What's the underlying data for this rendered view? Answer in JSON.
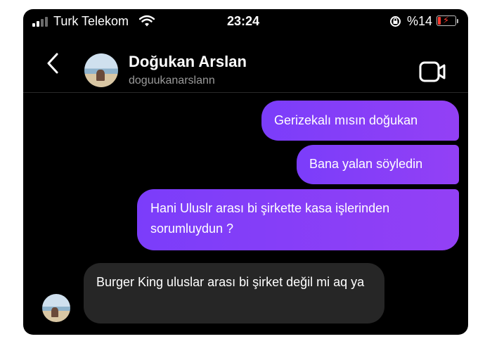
{
  "status_bar": {
    "carrier": "Turk Telekom",
    "time": "23:24",
    "battery_percent": "%14",
    "battery_level": 0.14,
    "signal_bars": 2,
    "battery_color": "#ff3b30"
  },
  "header": {
    "name": "Doğukan Arslan",
    "username": "doguukanarslann"
  },
  "messages": [
    {
      "sender": "me",
      "text": "Gerizekalı mısın doğukan"
    },
    {
      "sender": "me",
      "text": "Bana yalan söyledin"
    },
    {
      "sender": "me",
      "text": "Hani Uluslr arası bi şirkette kasa işlerinden sorumluydun ?"
    },
    {
      "sender": "them",
      "text": "Burger King uluslar arası bi şirket değil mi aq ya"
    }
  ],
  "colors": {
    "sent_bubble": "#8a3ffc",
    "received_bubble": "#262626",
    "background": "#000000"
  },
  "icons": [
    "signal-icon",
    "wifi-icon",
    "rotation-lock-icon",
    "battery-icon",
    "back-chevron-icon",
    "video-call-icon"
  ]
}
